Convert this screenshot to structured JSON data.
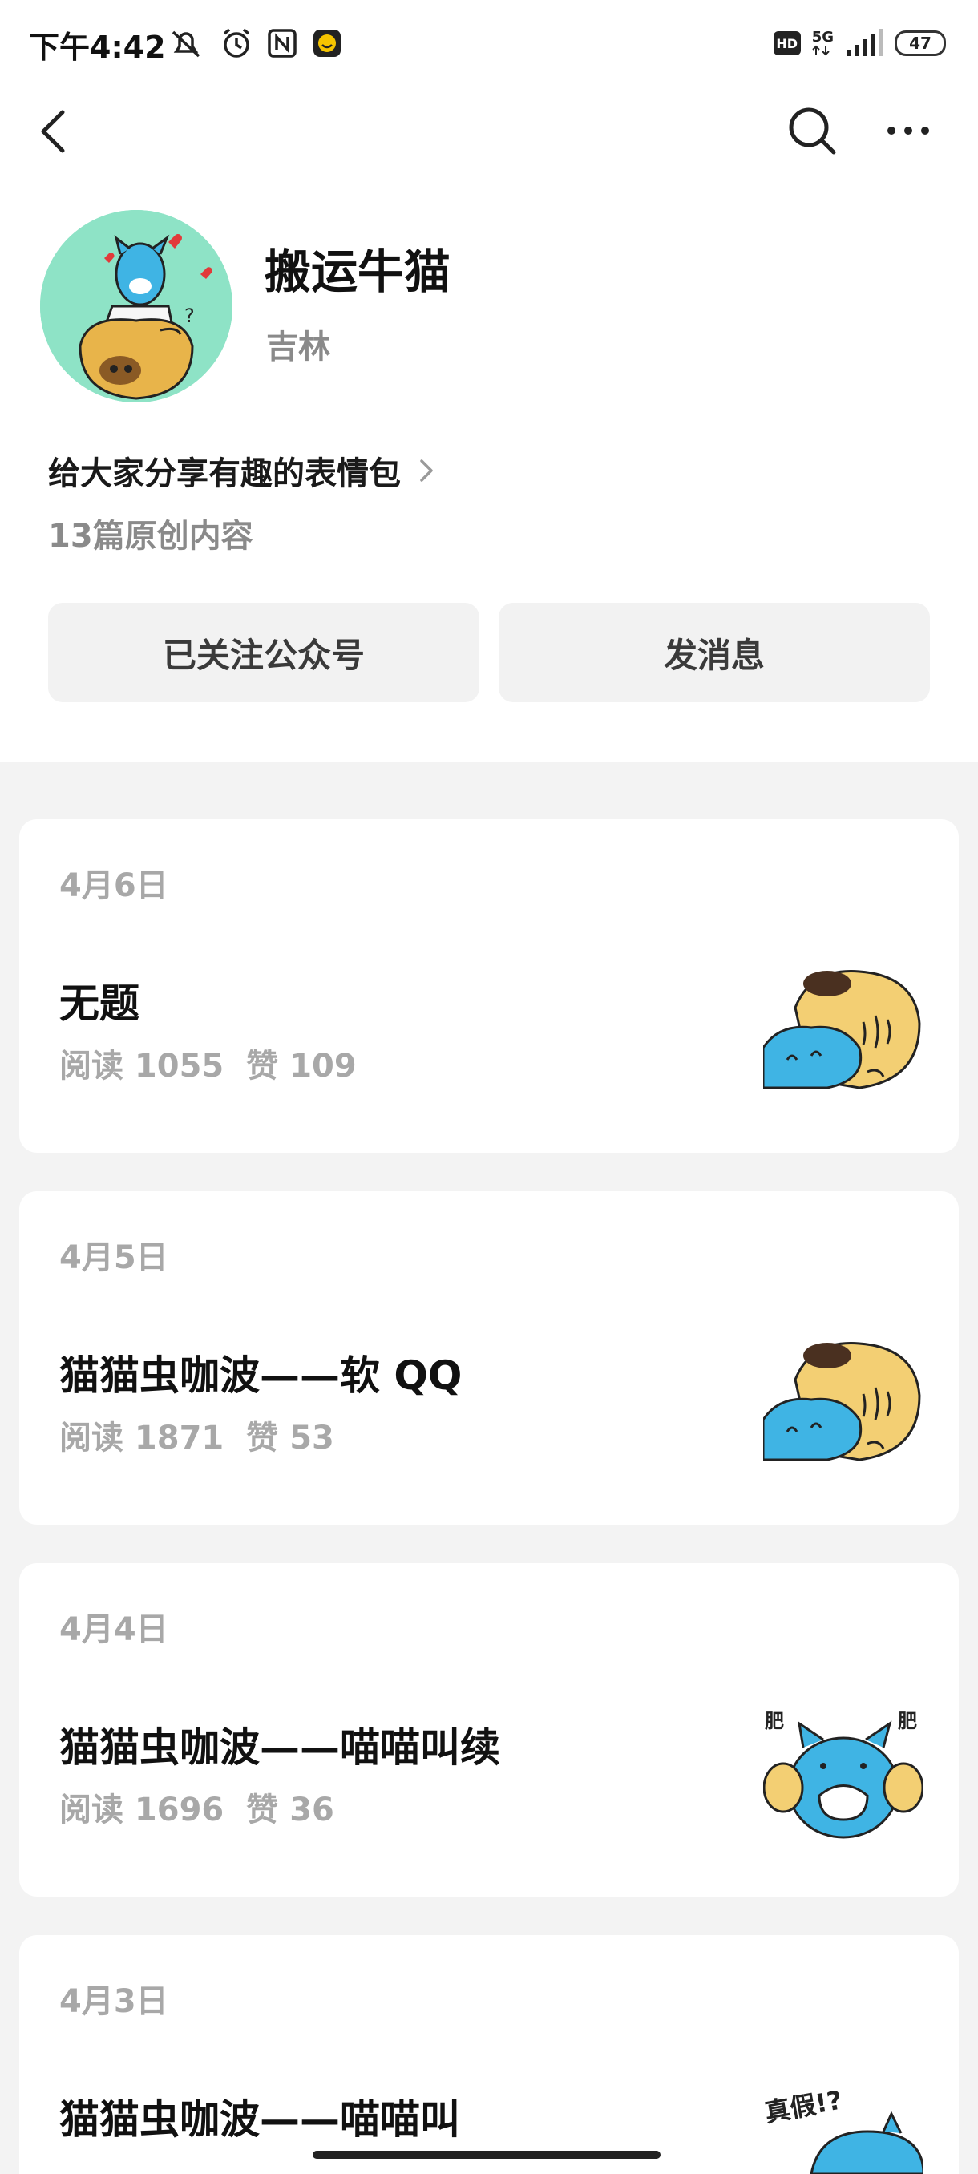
{
  "status_bar": {
    "time": "下午4:42",
    "hd": "HD",
    "network": "5G",
    "battery": "47"
  },
  "profile": {
    "name": "搬运牛猫",
    "region": "吉林",
    "intro": "给大家分享有趣的表情包",
    "original_count": "13篇原创内容"
  },
  "actions": {
    "follow_label": "已关注公众号",
    "message_label": "发消息"
  },
  "articles": [
    {
      "date": "4月6日",
      "title": "无题",
      "reads": "阅读 1055",
      "likes": "赞 109"
    },
    {
      "date": "4月5日",
      "title": "猫猫虫咖波——软 QQ",
      "reads": "阅读 1871",
      "likes": "赞 53"
    },
    {
      "date": "4月4日",
      "title": "猫猫虫咖波——喵喵叫续",
      "reads": "阅读 1696",
      "likes": "赞 36"
    },
    {
      "date": "4月3日",
      "title": "猫猫虫咖波——喵喵叫",
      "reads": "",
      "likes": ""
    }
  ],
  "thumb_texts": {
    "fat_left": "肥",
    "fat_right": "肥",
    "really": "真假!?"
  },
  "colors": {
    "avatar_bg": "#8ee3c6",
    "page_bg": "#f3f3f3",
    "button_bg": "#f2f2f2",
    "meta_gray": "#a8a8a8"
  }
}
